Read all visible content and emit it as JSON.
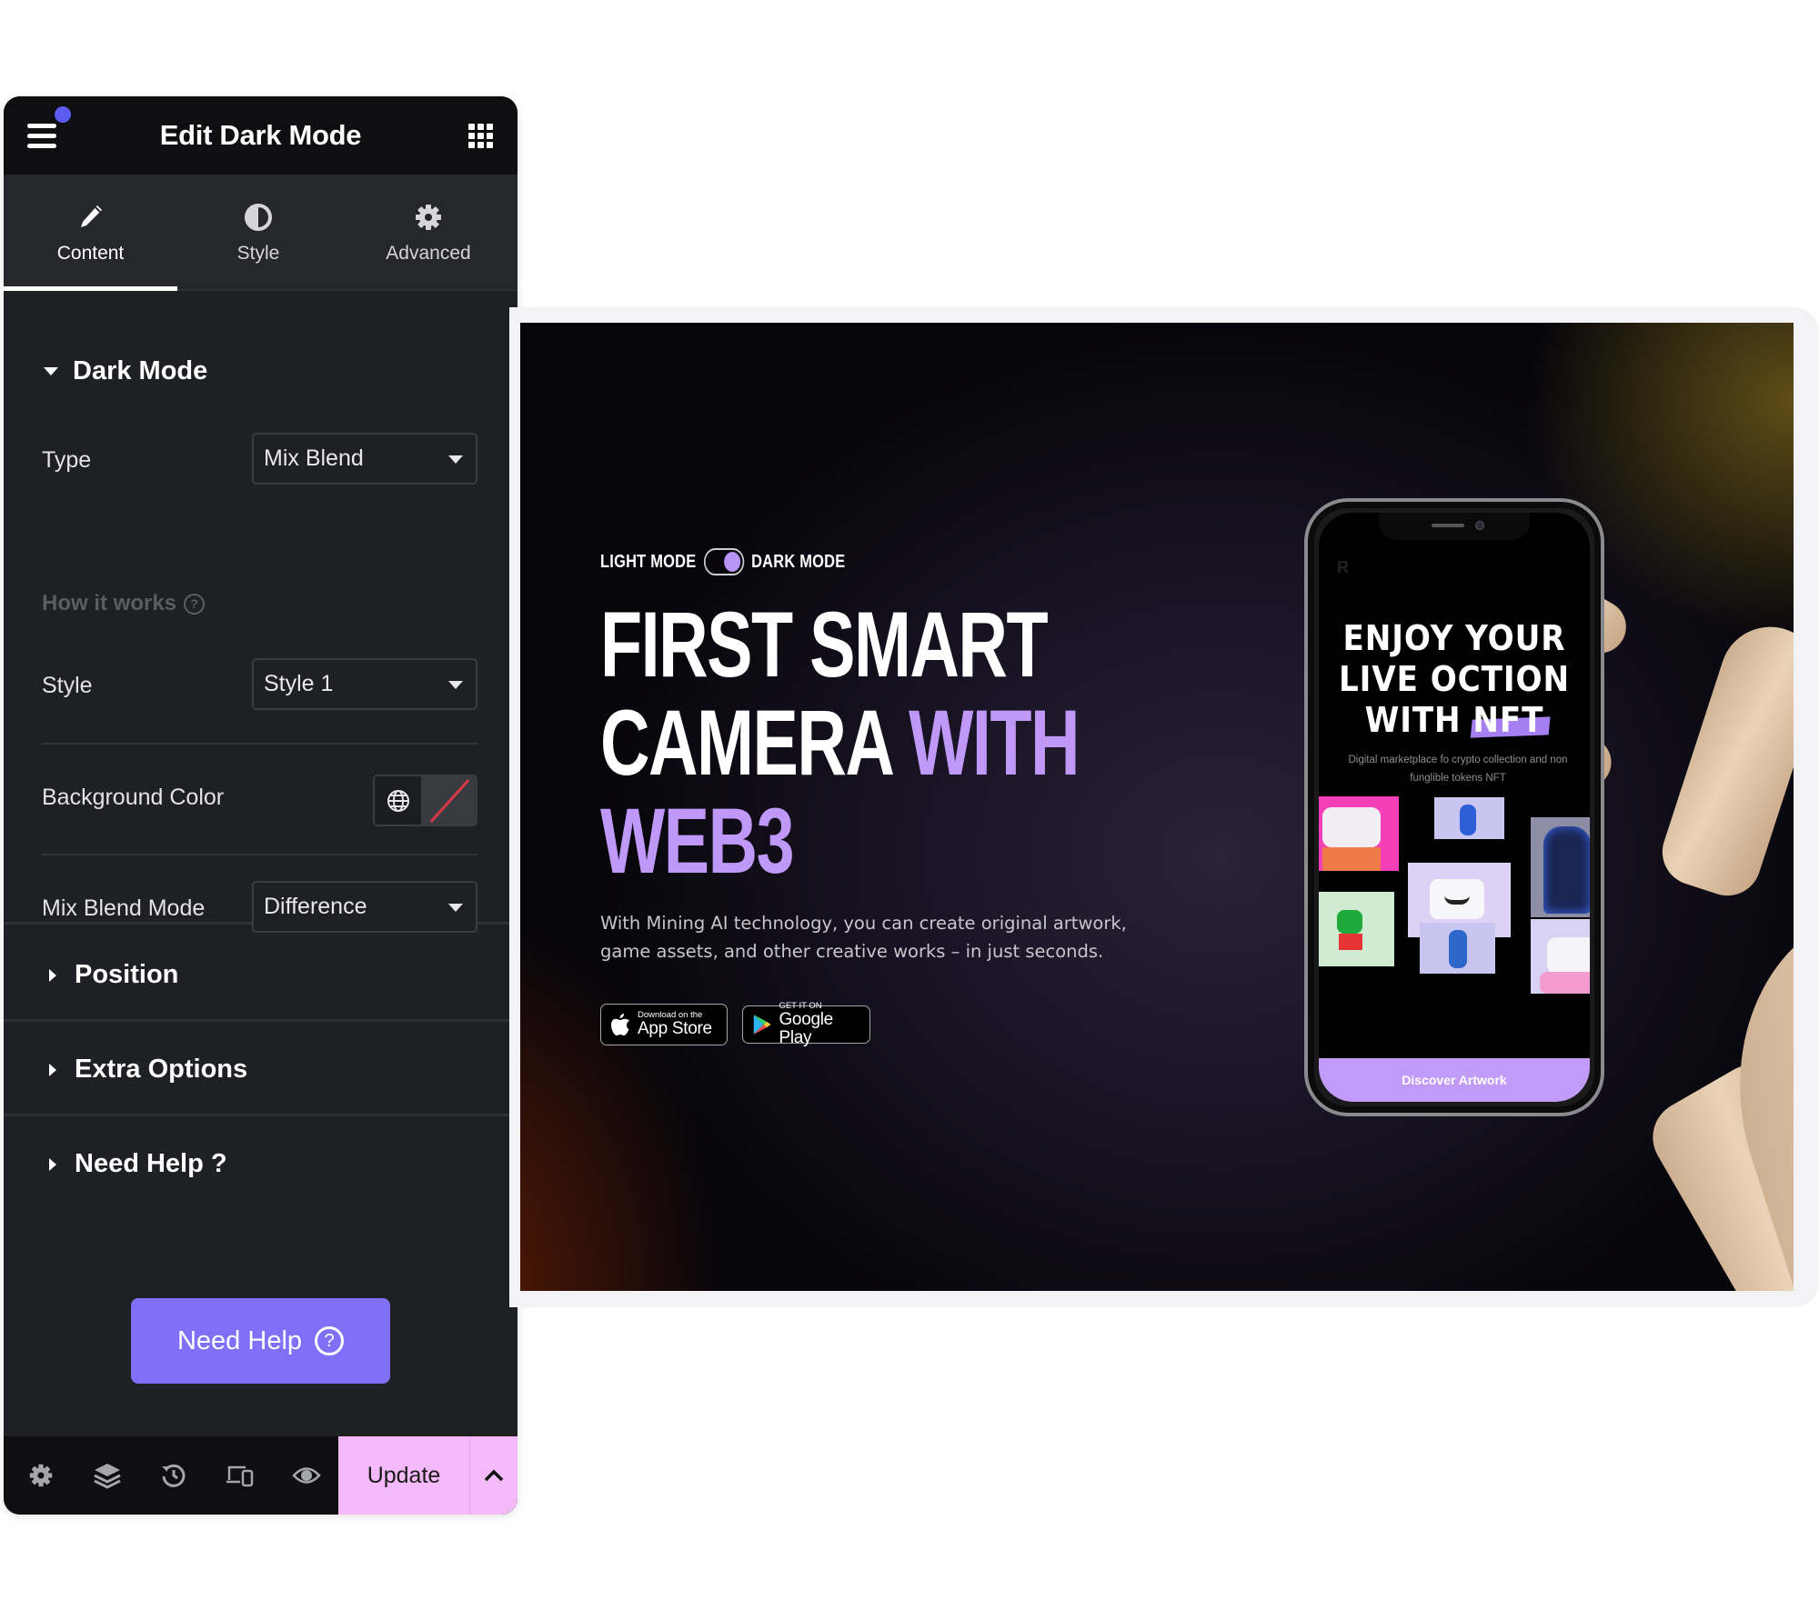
{
  "editor": {
    "title": "Edit Dark Mode",
    "menu_icon": "hamburger-icon",
    "apps_icon": "grid-icon",
    "tabs": [
      {
        "label": "Content",
        "icon": "pencil-icon",
        "active": true
      },
      {
        "label": "Style",
        "icon": "half-circle-icon",
        "active": false
      },
      {
        "label": "Advanced",
        "icon": "gear-icon",
        "active": false
      }
    ],
    "sections": {
      "dark_mode": {
        "title": "Dark Mode",
        "type_label": "Type",
        "type_value": "Mix Blend",
        "how_it_works": "How it works",
        "style_label": "Style",
        "style_value": "Style 1",
        "bg_color_label": "Background Color",
        "mix_blend_label": "Mix Blend Mode",
        "mix_blend_value": "Difference"
      },
      "position": {
        "title": "Position"
      },
      "extra_options": {
        "title": "Extra Options"
      },
      "need_help": {
        "title": "Need Help ?"
      }
    },
    "help_button": "Need Help",
    "footer": {
      "icons": [
        "gear-icon",
        "layers-icon",
        "history-icon",
        "responsive-icon",
        "eye-icon"
      ],
      "update_label": "Update"
    },
    "colors": {
      "accent": "#8070f8",
      "update_bg": "#f3b9f8",
      "notif_dot": "#5b5bf0"
    }
  },
  "preview": {
    "toggle_left": "LIGHT MODE",
    "toggle_right": "DARK MODE",
    "headline_line1": "FIRST SMART",
    "headline_line2a": "CAMERA",
    "headline_line2b": "WITH",
    "headline_line3": "WEB3",
    "subtext": "With Mining AI technology, you can create original artwork, game assets, and other creative works – in just seconds.",
    "appstore_small": "Download on the",
    "appstore_big": "App Store",
    "gplay_small": "GET IT ON",
    "gplay_big": "Google Play",
    "accent_color": "#bf98f8",
    "phone": {
      "logo": "R",
      "title_line1": "ENJOY YOUR",
      "title_line2": "LIVE OCTION",
      "title_line3a": "WITH",
      "title_line3b": "NFT",
      "subtitle": "Digital marketplace fo crypto collection and non funglible tokens  NFT",
      "cta": "Discover Artwork"
    }
  }
}
